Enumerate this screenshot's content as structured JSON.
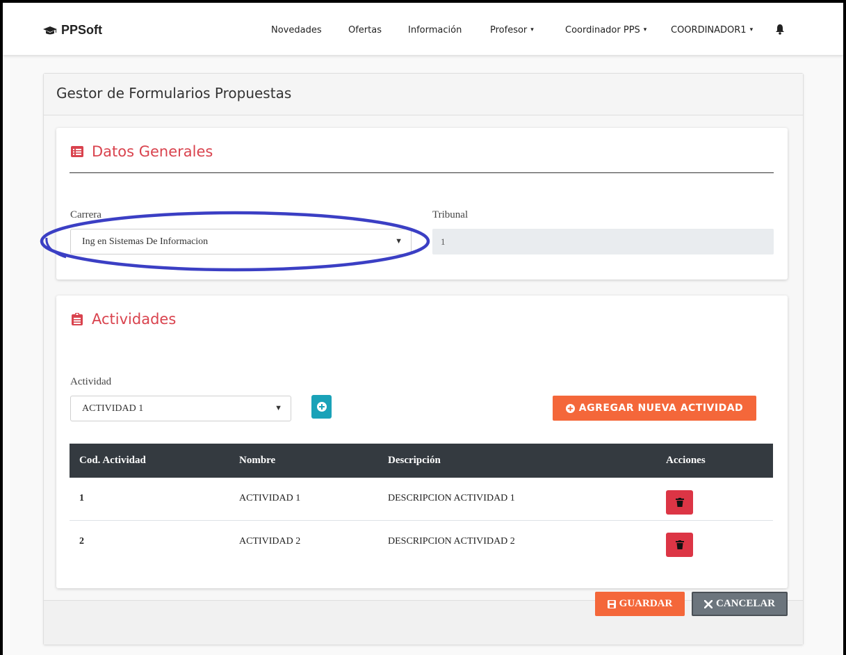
{
  "navbar": {
    "brand": "PPSoft",
    "items": [
      {
        "label": "Novedades",
        "dropdown": false
      },
      {
        "label": "Ofertas",
        "dropdown": false
      },
      {
        "label": "Información",
        "dropdown": false
      },
      {
        "label": "Profesor",
        "dropdown": true
      },
      {
        "label": "Coordinador PPS",
        "dropdown": true
      },
      {
        "label": "COORDINADOR1",
        "dropdown": true
      }
    ],
    "caret": "▾",
    "icons": {
      "brand": "graduation-cap-icon",
      "notifications": "bell-icon"
    }
  },
  "page": {
    "title": "Gestor de Formularios Propuestas"
  },
  "datos_generales": {
    "title": "Datos Generales",
    "icon": "list-alt-icon",
    "carrera_label": "Carrera",
    "carrera_value": "Ing en Sistemas De Informacion",
    "tribunal_label": "Tribunal",
    "tribunal_value": "1",
    "annotation_color": "#3b3fc4"
  },
  "actividades": {
    "title": "Actividades",
    "icon": "clipboard-list-icon",
    "actividad_label": "Actividad",
    "actividad_value": "ACTIVIDAD 1",
    "select_arrow": "▼",
    "add_button_icon": "plus-circle-icon",
    "new_button_label": "AGREGAR NUEVA ACTIVIDAD",
    "columns": [
      "Cod. Actividad",
      "Nombre",
      "Descripción",
      "Acciones"
    ],
    "rows": [
      {
        "cod": "1",
        "nombre": "ACTIVIDAD 1",
        "descripcion": "DESCRIPCION ACTIVIDAD 1"
      },
      {
        "cod": "2",
        "nombre": "ACTIVIDAD 2",
        "descripcion": "DESCRIPCION ACTIVIDAD 2"
      }
    ],
    "delete_icon": "trash-icon"
  },
  "footer": {
    "save_label": "GUARDAR",
    "save_icon": "save-icon",
    "cancel_label": "CANCELAR",
    "cancel_icon": "times-icon"
  },
  "colors": {
    "accent_red": "#d9434e",
    "orange": "#f4673a",
    "teal": "#1aa2b8",
    "danger": "#dc3545",
    "dark": "#343a40",
    "secondary": "#6c757d"
  }
}
